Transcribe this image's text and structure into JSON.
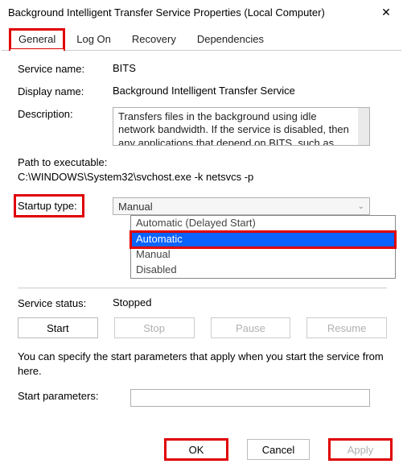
{
  "window": {
    "title": "Background Intelligent Transfer Service Properties (Local Computer)"
  },
  "tabs": {
    "general": "General",
    "logon": "Log On",
    "recovery": "Recovery",
    "dependencies": "Dependencies"
  },
  "labels": {
    "service_name": "Service name:",
    "display_name": "Display name:",
    "description": "Description:",
    "path_label": "Path to executable:",
    "startup_type": "Startup type:",
    "service_status": "Service status:",
    "start_params": "Start parameters:"
  },
  "values": {
    "service_name": "BITS",
    "display_name": "Background Intelligent Transfer Service",
    "description": "Transfers files in the background using idle network bandwidth. If the service is disabled, then any applications that depend on BITS, such as Windows",
    "path": "C:\\WINDOWS\\System32\\svchost.exe -k netsvcs -p",
    "startup_current": "Manual",
    "service_status": "Stopped",
    "start_params": ""
  },
  "dropdown": {
    "opt0": "Automatic (Delayed Start)",
    "opt1": "Automatic",
    "opt2": "Manual",
    "opt3": "Disabled"
  },
  "buttons": {
    "start": "Start",
    "stop": "Stop",
    "pause": "Pause",
    "resume": "Resume",
    "ok": "OK",
    "cancel": "Cancel",
    "apply": "Apply"
  },
  "hint": "You can specify the start parameters that apply when you start the service from here."
}
